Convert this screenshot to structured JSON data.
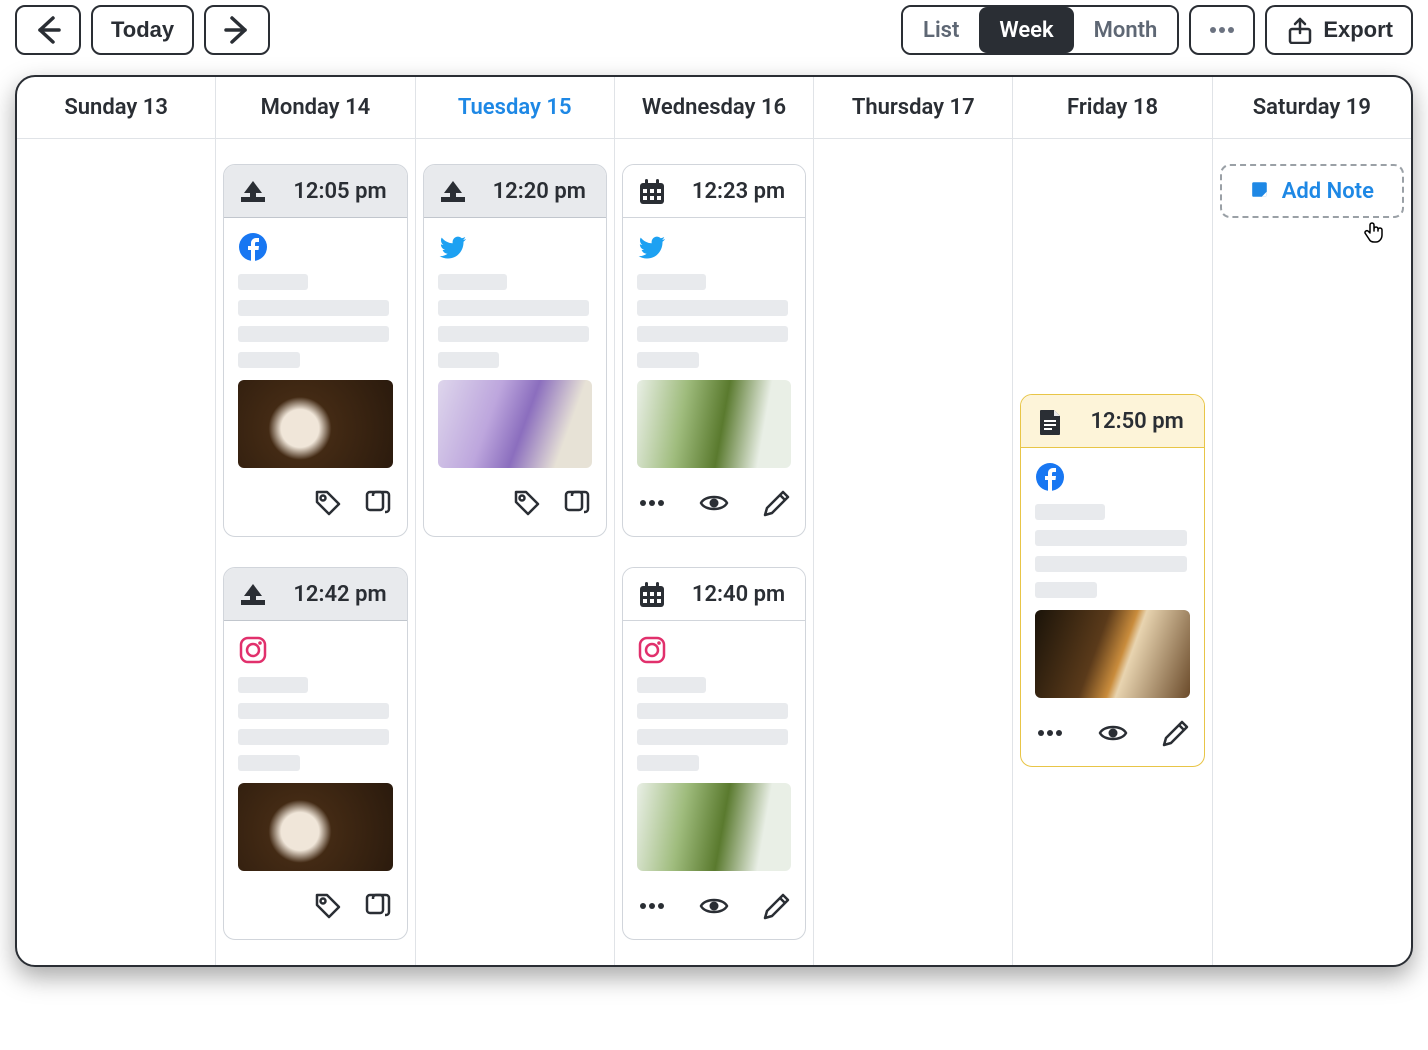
{
  "toolbar": {
    "today": "Today",
    "views": {
      "list": "List",
      "week": "Week",
      "month": "Month",
      "active": "week"
    },
    "export": "Export"
  },
  "days": [
    {
      "label": "Sunday 13",
      "today": false
    },
    {
      "label": "Monday 14",
      "today": false
    },
    {
      "label": "Tuesday 15",
      "today": true
    },
    {
      "label": "Wednesday 16",
      "today": false
    },
    {
      "label": "Thursday 17",
      "today": false
    },
    {
      "label": "Friday 18",
      "today": false
    },
    {
      "label": "Saturday 19",
      "today": false
    }
  ],
  "addNote": "Add Note",
  "cards": {
    "monday": [
      {
        "status": "sent",
        "time": "12:05 pm",
        "network": "facebook",
        "thumb": "coffee",
        "actions": "sent"
      },
      {
        "status": "sent",
        "time": "12:42 pm",
        "network": "instagram",
        "thumb": "coffee",
        "actions": "sent"
      }
    ],
    "tuesday": [
      {
        "status": "sent",
        "time": "12:20 pm",
        "network": "twitter",
        "thumb": "lilac",
        "actions": "sent"
      }
    ],
    "wednesday": [
      {
        "status": "scheduled",
        "time": "12:23 pm",
        "network": "twitter",
        "thumb": "matcha",
        "actions": "scheduled"
      },
      {
        "status": "scheduled",
        "time": "12:40 pm",
        "network": "instagram",
        "thumb": "matcha",
        "actions": "scheduled"
      }
    ],
    "friday": [
      {
        "status": "draft",
        "time": "12:50 pm",
        "network": "facebook",
        "thumb": "whisky",
        "actions": "scheduled"
      }
    ]
  },
  "icons": {
    "arrow_left": "arrow-left-icon",
    "arrow_right": "arrow-right-icon",
    "more": "more-icon",
    "share": "share-icon",
    "upload": "upload-icon",
    "calendar": "calendar-icon",
    "doc": "doc-icon",
    "tag": "tag-icon",
    "copy": "copy-icon",
    "dots": "dots-icon",
    "eye": "eye-icon",
    "pencil": "pencil-icon",
    "note": "note-icon"
  },
  "networks": {
    "facebook": "facebook-icon",
    "twitter": "twitter-icon",
    "instagram": "instagram-icon"
  }
}
